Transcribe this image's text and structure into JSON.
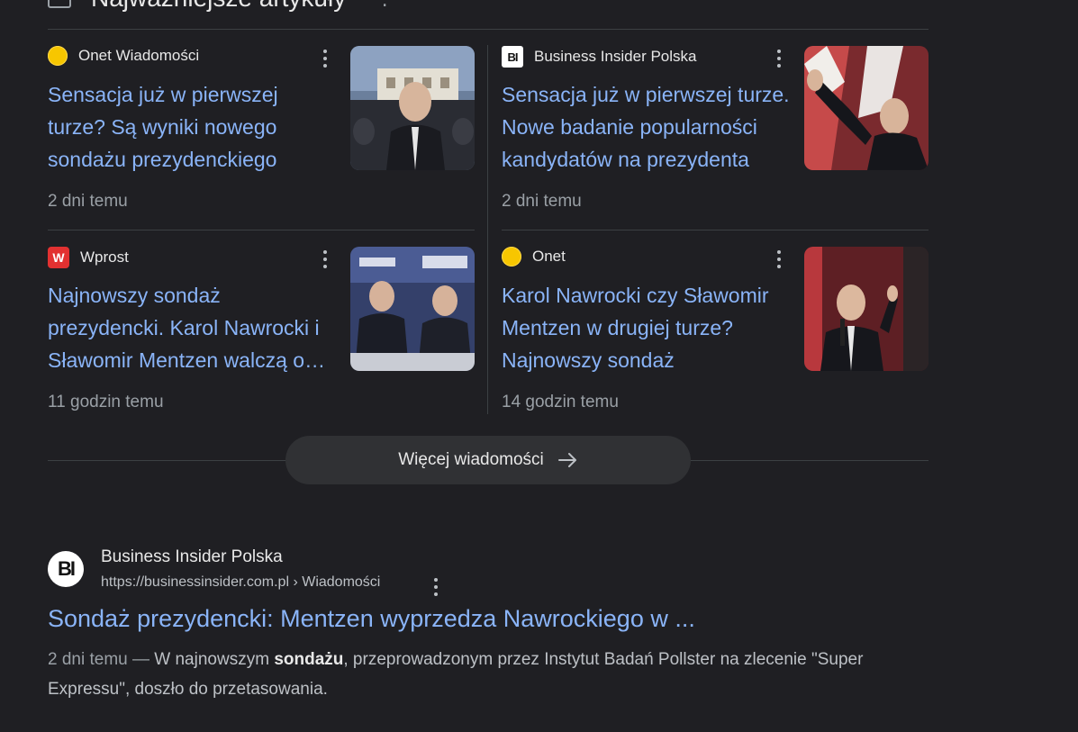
{
  "header": {
    "title": "Najważniejsze artykuły"
  },
  "cards": [
    {
      "source": "Onet Wiadomości",
      "favicon": "onet-icon",
      "title": "Sensacja już w pierwszej turze? Są wyniki nowego sondażu prezydenckiego",
      "time": "2 dni temu"
    },
    {
      "source": "Business Insider Polska",
      "favicon": "bi-icon",
      "favicon_text": "BI",
      "title": "Sensacja już w pierwszej turze. Nowe badanie popularności kandydatów na prezydenta",
      "time": "2 dni temu"
    },
    {
      "source": "Wprost",
      "favicon": "wprost-icon",
      "favicon_text": "W",
      "title": "Najnowszy sondaż prezydencki. Karol Nawrocki i Sławomir Mentzen walczą o drugie miejsce",
      "time": "11 godzin temu"
    },
    {
      "source": "Onet",
      "favicon": "onet-icon",
      "title": "Karol Nawrocki czy Sławomir Mentzen w drugiej turze? Najnowszy sondaż",
      "time": "14 godzin temu"
    }
  ],
  "more_button": {
    "label": "Więcej wiadomości"
  },
  "result": {
    "favicon_text": "BI",
    "site": "Business Insider Polska",
    "url": "https://businessinsider.com.pl › Wiadomości",
    "title": "Sondaż prezydencki: Mentzen wyprzedza Nawrockiego w ...",
    "snippet_date": "2 dni temu —",
    "snippet_pre": " W najnowszym ",
    "snippet_bold": "sondażu",
    "snippet_post": ", przeprowadzonym przez Instytut Badań Pollster na zlecenie \"Super Expressu\", doszło do przetasowania."
  },
  "colors": {
    "background": "#1f1f23",
    "link": "#8ab4f8",
    "muted": "#9aa0a6",
    "divider": "#3c4043",
    "button": "#303134"
  }
}
